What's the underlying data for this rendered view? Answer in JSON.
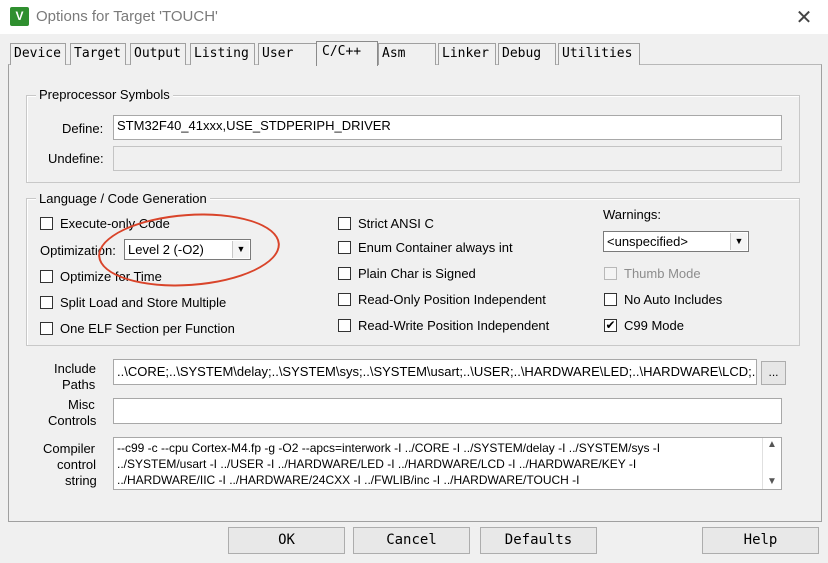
{
  "window": {
    "title": "Options for Target 'TOUCH'",
    "icon": "keil-uvision-icon",
    "close_glyph": "✕"
  },
  "tabs": [
    {
      "label": "Device"
    },
    {
      "label": "Target"
    },
    {
      "label": "Output"
    },
    {
      "label": "Listing"
    },
    {
      "label": "User"
    },
    {
      "label": "C/C++",
      "active": true
    },
    {
      "label": "Asm"
    },
    {
      "label": "Linker"
    },
    {
      "label": "Debug"
    },
    {
      "label": "Utilities"
    }
  ],
  "preprocessor": {
    "group_label": "Preprocessor Symbols",
    "define_label": "Define:",
    "define_value": "STM32F40_41xxx,USE_STDPERIPH_DRIVER",
    "undefine_label": "Undefine:",
    "undefine_value": ""
  },
  "codegen": {
    "group_label": "Language / Code Generation",
    "execute_only": {
      "label": "Execute-only Code",
      "checked": false
    },
    "optimization_label": "Optimization:",
    "optimization_value": "Level 2 (-O2)",
    "optimize_time": {
      "label": "Optimize for Time",
      "checked": false
    },
    "split_load": {
      "label": "Split Load and Store Multiple",
      "checked": false
    },
    "one_elf": {
      "label": "One ELF Section per Function",
      "checked": false
    },
    "strict_ansi": {
      "label": "Strict ANSI C",
      "checked": false
    },
    "enum_container": {
      "label": "Enum Container always int",
      "checked": false
    },
    "plain_char": {
      "label": "Plain Char is Signed",
      "checked": false
    },
    "ro_pi": {
      "label": "Read-Only Position Independent",
      "checked": false
    },
    "rw_pi": {
      "label": "Read-Write Position Independent",
      "checked": false
    },
    "warnings_label": "Warnings:",
    "warnings_value": "<unspecified>",
    "thumb_mode": {
      "label": "Thumb Mode",
      "checked": false,
      "disabled": true
    },
    "no_auto_includes": {
      "label": "No Auto Includes",
      "checked": false
    },
    "c99_mode": {
      "label": "C99 Mode",
      "checked": true
    },
    "check_glyph": "✔",
    "annotation_color": "#d9442a"
  },
  "include_paths": {
    "label_line1": "Include",
    "label_line2": "Paths",
    "value": "..\\CORE;..\\SYSTEM\\delay;..\\SYSTEM\\sys;..\\SYSTEM\\usart;..\\USER;..\\HARDWARE\\LED;..\\HARDWARE\\LCD;..\\HARDWARE\\KEY",
    "browse_label": "..."
  },
  "misc_controls": {
    "label_line1": "Misc",
    "label_line2": "Controls",
    "value": ""
  },
  "compiler_string": {
    "label_line1": "Compiler",
    "label_line2": "control",
    "label_line3": "string",
    "line1": "--c99 -c --cpu Cortex-M4.fp -g -O2 --apcs=interwork -I ../CORE -I ../SYSTEM/delay -I ../SYSTEM/sys -I",
    "line2": "../SYSTEM/usart -I ../USER -I ../HARDWARE/LED -I ../HARDWARE/LCD -I ../HARDWARE/KEY -I",
    "line3": "../HARDWARE/IIC -I ../HARDWARE/24CXX -I ../FWLIB/inc -I ../HARDWARE/TOUCH -I"
  },
  "buttons": {
    "ok": "OK",
    "cancel": "Cancel",
    "defaults": "Defaults",
    "help": "Help"
  }
}
